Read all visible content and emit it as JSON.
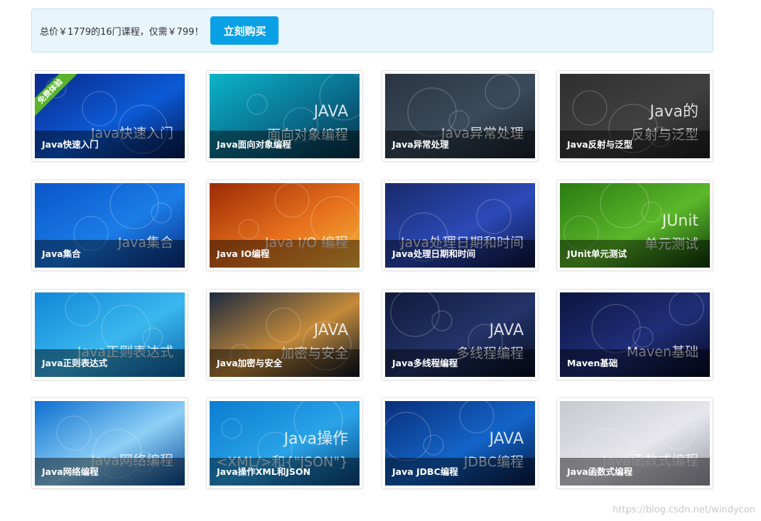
{
  "promo": {
    "text": "总价￥1779的16门课程，仅需￥799！",
    "button_label": "立刻购买"
  },
  "free_ribbon": "免费体验",
  "courses": [
    {
      "title": "Java快速入门",
      "art": "Java快速入门",
      "colors": [
        "#0a2a8a",
        "#0c5ad6",
        "#041a55"
      ]
    },
    {
      "title": "Java面向对象编程",
      "art": "JAVA\n面向对象编程",
      "colors": [
        "#0bb5c8",
        "#0a6e8e",
        "#063047"
      ]
    },
    {
      "title": "Java异常处理",
      "art": "Java异常处理",
      "colors": [
        "#2a3440",
        "#3a4b5c",
        "#1a222b"
      ]
    },
    {
      "title": "Java反射与泛型",
      "art": "Java的\n反射与泛型",
      "colors": [
        "#2f2f2f",
        "#404040",
        "#1f1f1f"
      ]
    },
    {
      "title": "Java集合",
      "art": "Java集合",
      "colors": [
        "#0a55c9",
        "#1b7de8",
        "#0a2f85"
      ]
    },
    {
      "title": "Java IO编程",
      "art": "Java I/O 编程",
      "colors": [
        "#9a2b05",
        "#e7711d",
        "#f3b63a"
      ]
    },
    {
      "title": "Java处理日期和时间",
      "art": "Java处理日期和时间",
      "colors": [
        "#182a6b",
        "#2c4ab8",
        "#0b1440"
      ]
    },
    {
      "title": "JUnit单元测试",
      "art": "JUnit\n单元测试",
      "colors": [
        "#2b7a12",
        "#5cb82a",
        "#0e3a08"
      ]
    },
    {
      "title": "Java正则表达式",
      "art": "Java正则表达式",
      "colors": [
        "#1287d6",
        "#3ab7ef",
        "#0b62a8"
      ]
    },
    {
      "title": "Java加密与安全",
      "art": "JAVA\n加密与安全",
      "colors": [
        "#1d2a40",
        "#c48a3a",
        "#0d1524"
      ]
    },
    {
      "title": "Java多线程编程",
      "art": "JAVA\n多线程编程",
      "colors": [
        "#0f1a3a",
        "#24346a",
        "#070d20"
      ]
    },
    {
      "title": "Maven基础",
      "art": "Maven基础",
      "colors": [
        "#0c1640",
        "#1f2e78",
        "#050a22"
      ]
    },
    {
      "title": "Java网络编程",
      "art": "Java网络编程",
      "colors": [
        "#0d6fcf",
        "#8ed0f6",
        "#064b99"
      ]
    },
    {
      "title": "Java操作XML和JSON",
      "art": "Java操作\n<XML/>和{\"JSON\"}",
      "colors": [
        "#0b7dd0",
        "#2aa3e8",
        "#06467e"
      ]
    },
    {
      "title": "Java JDBC编程",
      "art": "JAVA\nJDBC编程",
      "colors": [
        "#0a2f7a",
        "#1364c8",
        "#061a45"
      ]
    },
    {
      "title": "Java函数式编程",
      "art": "Java函数式编程",
      "colors": [
        "#c8c8cf",
        "#e6e6ec",
        "#9a9aa5"
      ]
    }
  ],
  "watermark": "https://blog.csdn.net/windycon"
}
